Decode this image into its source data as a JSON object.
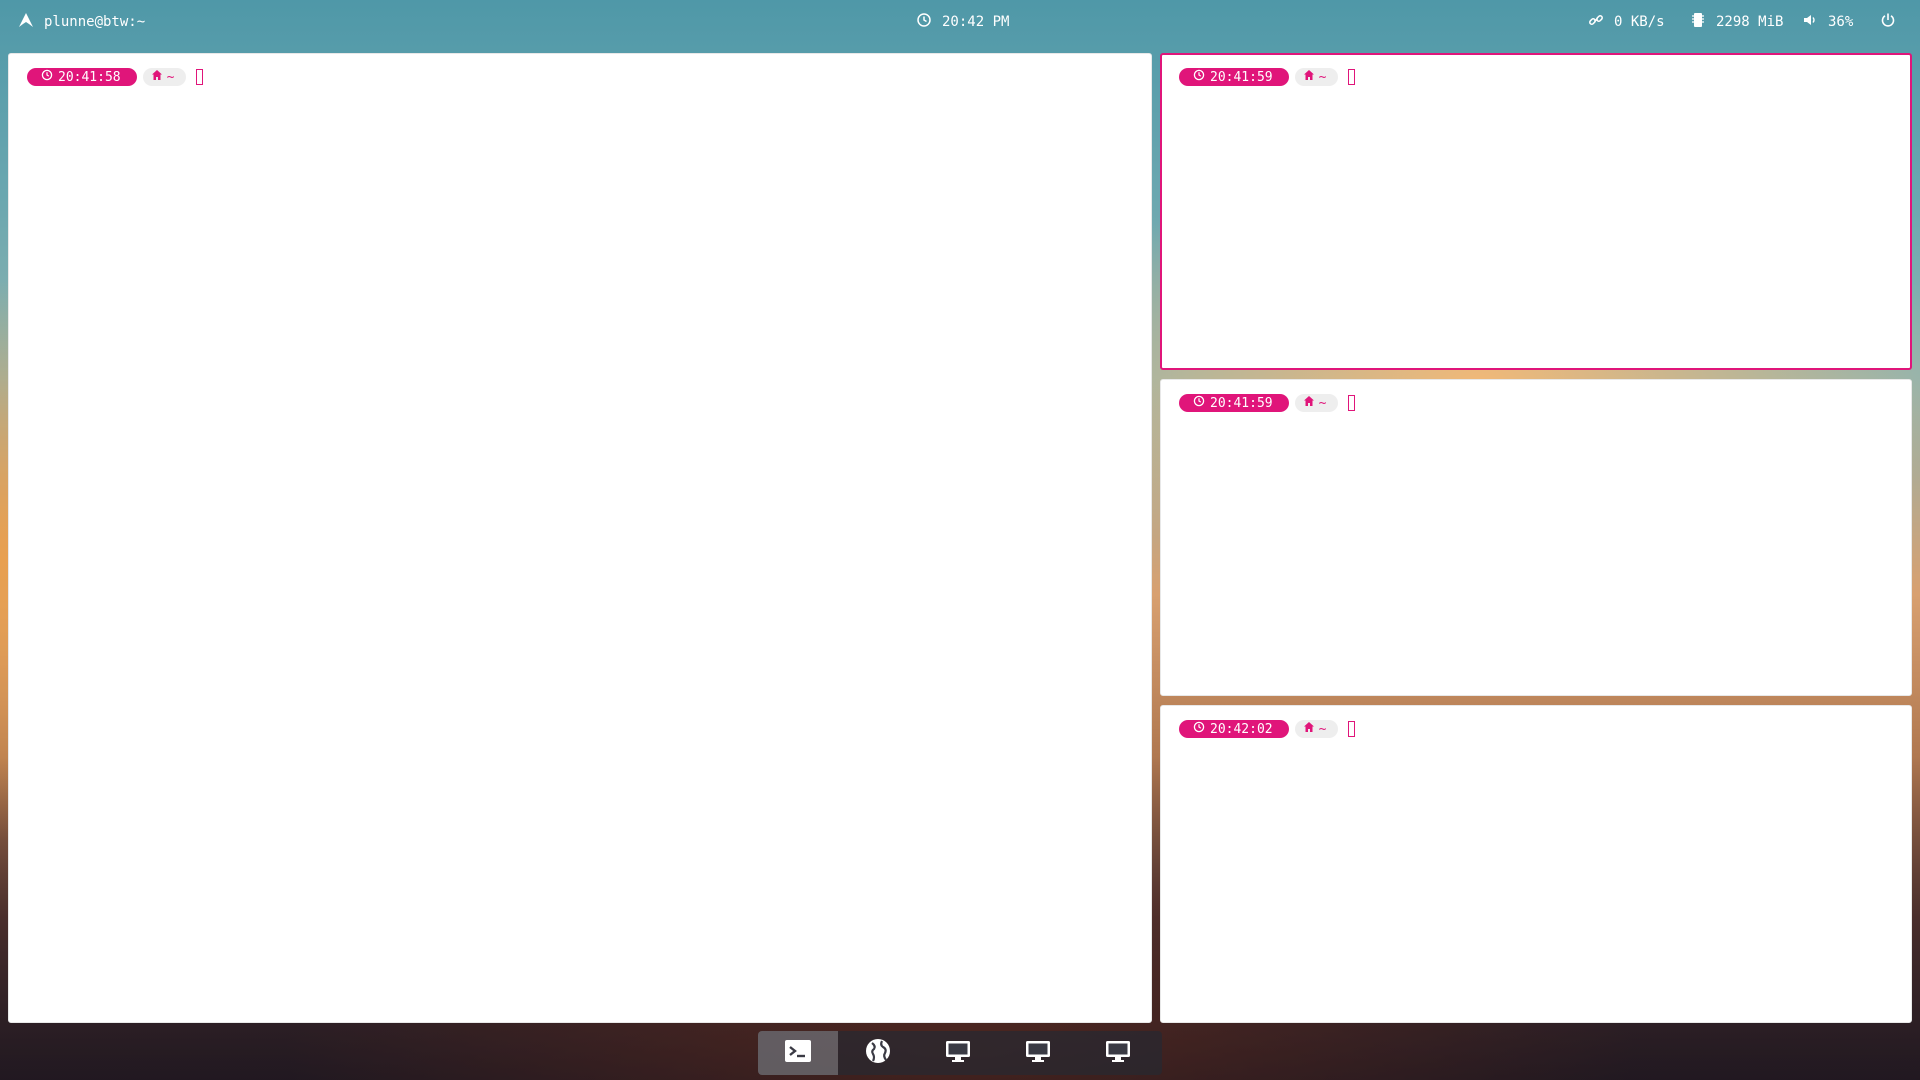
{
  "topbar": {
    "title": "plunne@btw:~",
    "clock": "20:42 PM",
    "network": "0 KB/s",
    "memory": "2298 MiB",
    "volume": "36%",
    "icons": [
      "arch-logo-icon",
      "clock-icon",
      "link-icon",
      "memory-icon",
      "volume-icon",
      "power-icon"
    ]
  },
  "terminals": [
    {
      "time": "20:41:58",
      "dir": "~",
      "focused": false
    },
    {
      "time": "20:41:59",
      "dir": "~",
      "focused": true
    },
    {
      "time": "20:41:59",
      "dir": "~",
      "focused": false
    },
    {
      "time": "20:42:02",
      "dir": "~",
      "focused": false
    }
  ],
  "dock": {
    "items": [
      {
        "name": "terminal-icon",
        "active": true
      },
      {
        "name": "globe-icon",
        "active": false
      },
      {
        "name": "monitor-icon",
        "active": false
      },
      {
        "name": "monitor-icon",
        "active": false
      },
      {
        "name": "monitor-icon",
        "active": false
      }
    ]
  },
  "colors": {
    "accent": "#e0157a",
    "window_bg": "#ffffff"
  }
}
